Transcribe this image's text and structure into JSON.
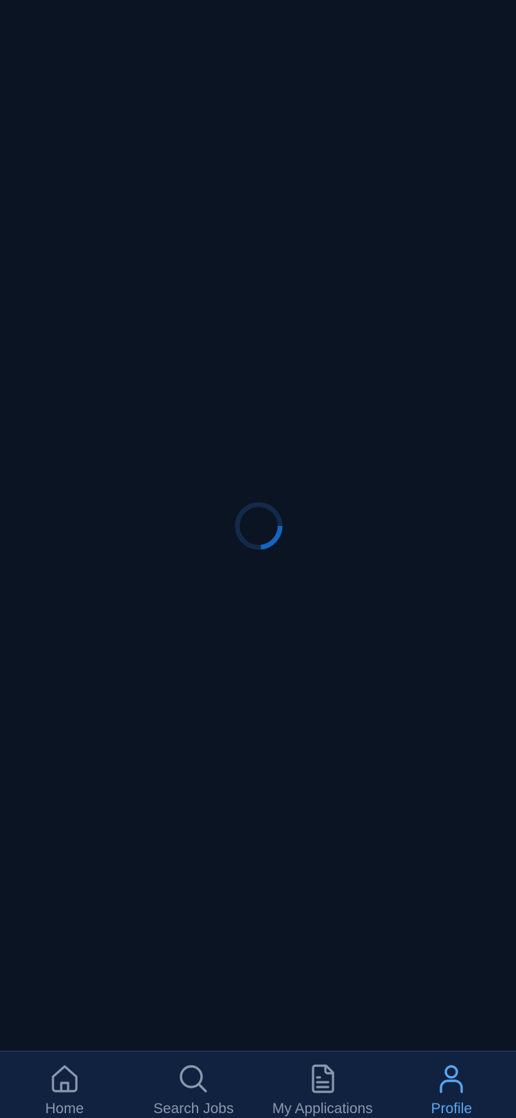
{
  "colors": {
    "background": "#0a1422",
    "tabbar_background": "#112240",
    "inactive": "#8a99ad",
    "active": "#5ba6f0",
    "spinner_track": "#132a4a",
    "spinner_arc": "#1565c0"
  },
  "loading": {
    "spinner_icon": "loading-spinner"
  },
  "tabbar": {
    "active_tab": "profile",
    "tabs": [
      {
        "id": "home",
        "label": "Home",
        "icon": "home-icon"
      },
      {
        "id": "search",
        "label": "Search Jobs",
        "icon": "search-icon"
      },
      {
        "id": "applications",
        "label": "My Applications",
        "icon": "document-icon"
      },
      {
        "id": "profile",
        "label": "Profile",
        "icon": "person-icon"
      }
    ]
  }
}
